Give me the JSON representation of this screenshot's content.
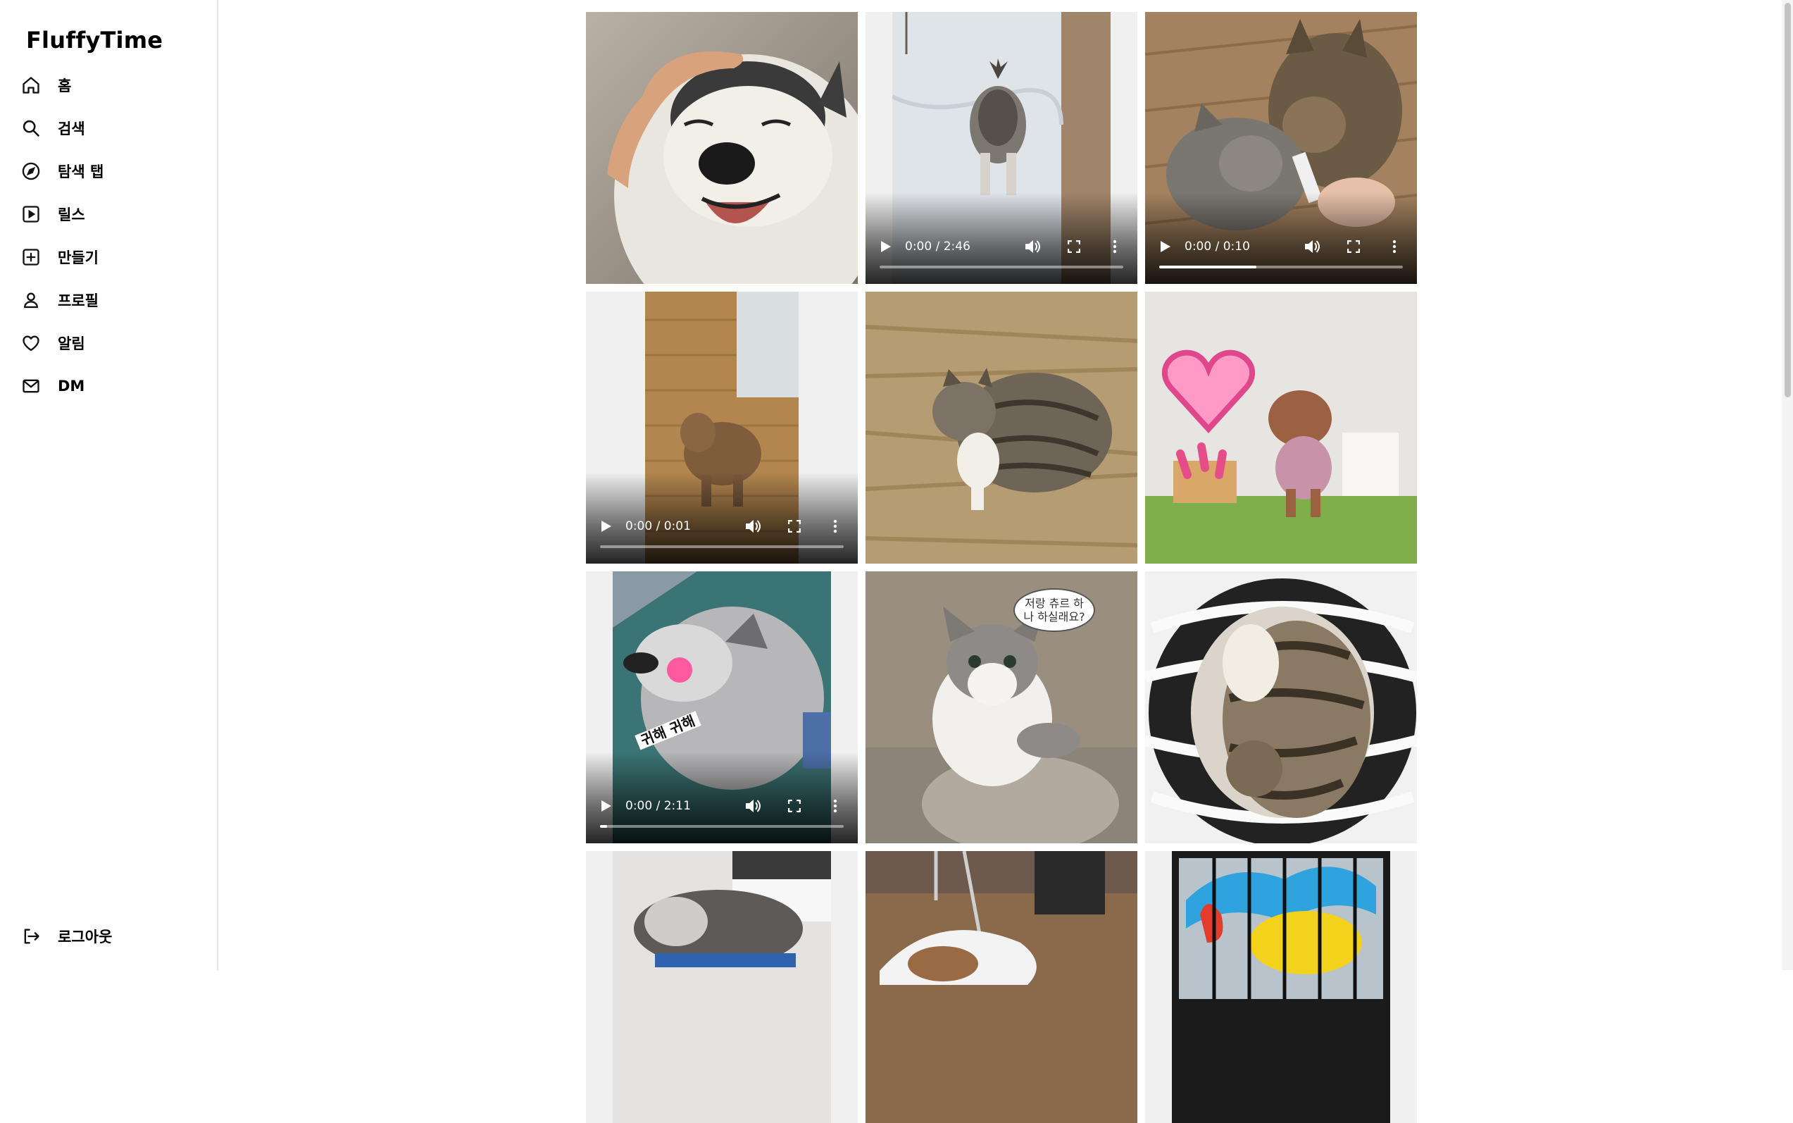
{
  "app": {
    "name": "FluffyTime"
  },
  "sidebar": {
    "items": [
      {
        "label": "홈",
        "icon": "home-icon"
      },
      {
        "label": "검색",
        "icon": "search-icon"
      },
      {
        "label": "탐색 탭",
        "icon": "compass-icon"
      },
      {
        "label": "릴스",
        "icon": "reels-icon"
      },
      {
        "label": "만들기",
        "icon": "create-icon"
      },
      {
        "label": "프로필",
        "icon": "profile-icon"
      },
      {
        "label": "알림",
        "icon": "heart-icon"
      },
      {
        "label": "DM",
        "icon": "mail-icon"
      }
    ],
    "logout": {
      "label": "로그아웃",
      "icon": "logout-icon"
    }
  },
  "feed": {
    "posts": [
      {
        "kind": "image",
        "subject": "husky being petted"
      },
      {
        "kind": "video",
        "subject": "husky walking in snow",
        "time": "0:00 / 2:46",
        "progress": 0,
        "caption": ""
      },
      {
        "kind": "video",
        "subject": "two cats eating a treat",
        "time": "0:00 / 0:10",
        "progress": 0.4
      },
      {
        "kind": "video",
        "subject": "poodle on wooden floor",
        "time": "0:00 / 0:01",
        "progress": 0
      },
      {
        "kind": "image",
        "subject": "tabby cat on dry grass"
      },
      {
        "kind": "image",
        "subject": "toy poodle with heart mirror"
      },
      {
        "kind": "video",
        "subject": "husky with pink toy",
        "time": "0:00 / 2:11",
        "progress": 0.03,
        "caption": "귀해 귀해"
      },
      {
        "kind": "image",
        "subject": "kitten on sofa",
        "bubble": "저랑 츄르 하\n나 하실래요?"
      },
      {
        "kind": "image",
        "subject": "two cats cuddling in zebra bed"
      },
      {
        "kind": "video",
        "subject": "husky on bed"
      },
      {
        "kind": "image",
        "subject": "cat in shopping bag"
      },
      {
        "kind": "video",
        "subject": "store window with cat mural"
      }
    ]
  },
  "colors": {
    "sidebar_border": "#e4e4e4",
    "tile_letterbox": "#f0f0f0"
  }
}
